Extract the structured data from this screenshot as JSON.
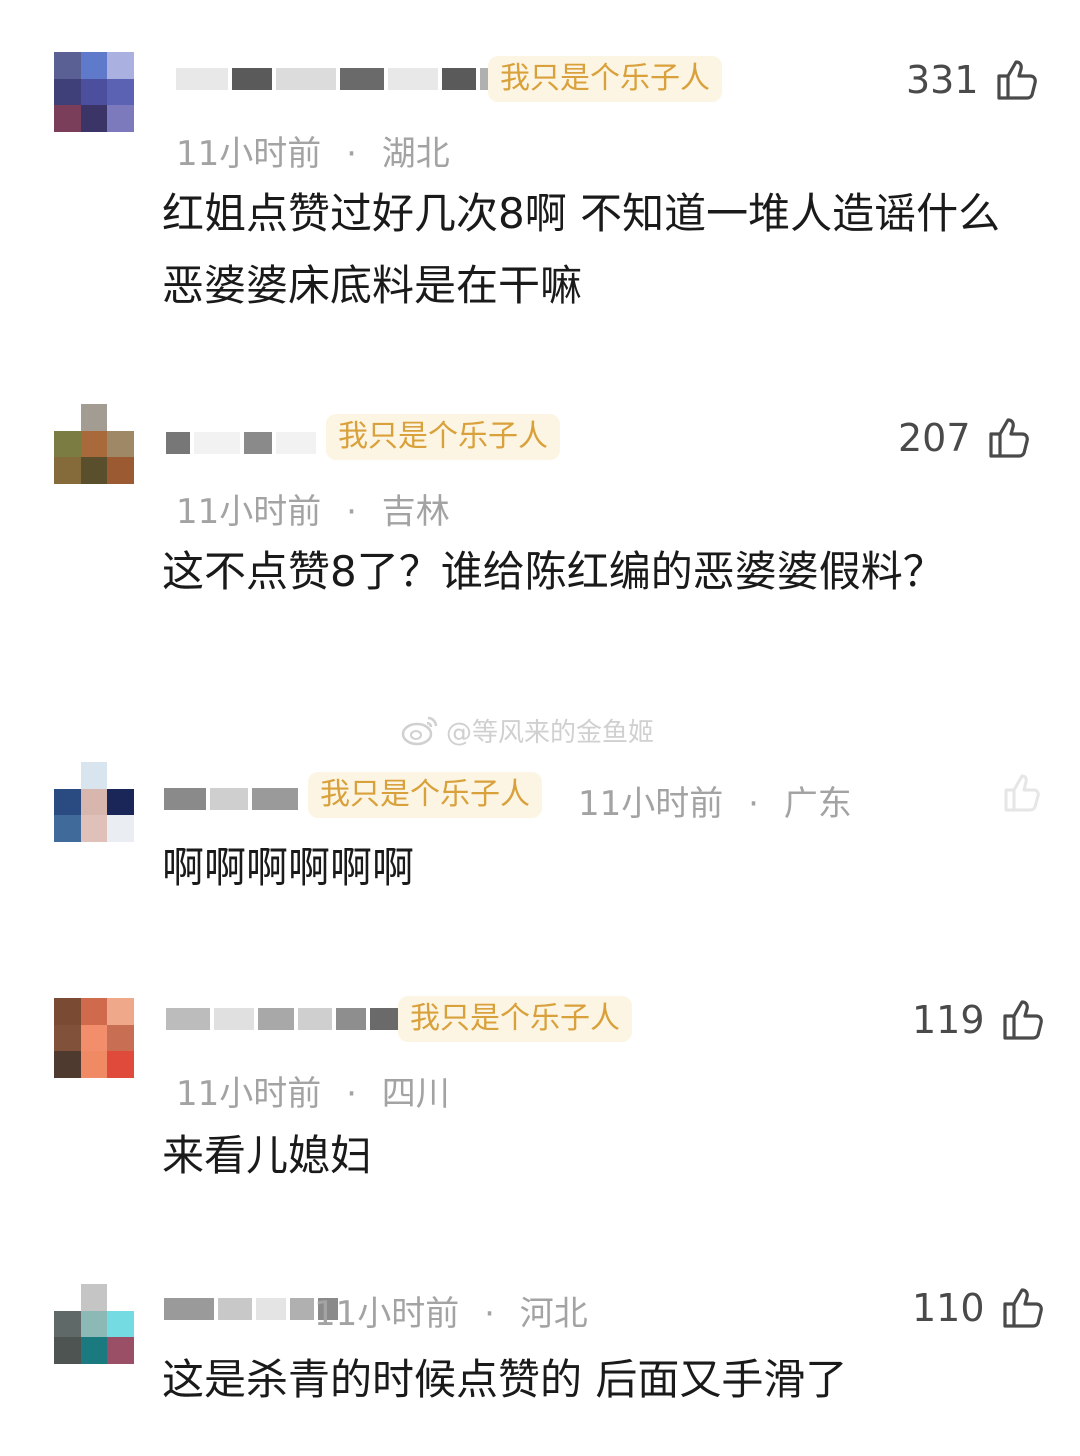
{
  "comments": [
    {
      "badge": "我只是个乐子人",
      "time": "11小时前",
      "location": "湖北",
      "text": "红姐点赞过好几次8啊 不知道一堆人造谣什么恶婆婆床底料是在干嘛",
      "likes": "331",
      "avatar_colors": [
        "#5a5f94",
        "#5f79cb",
        "#aab0e0",
        "#3f3f7a",
        "#4b4f9e",
        "#5b61b3",
        "#7a3d5a",
        "#3a3566",
        "#7c79bd"
      ]
    },
    {
      "badge": "我只是个乐子人",
      "time": "11小时前",
      "location": "吉林",
      "text": "这不点赞8了？谁给陈红编的恶婆婆假料？",
      "likes": "207",
      "avatar_colors": [
        "#ffffff",
        "#a39c93",
        "#ffffff",
        "#7a7c41",
        "#a86a3b",
        "#9e8866",
        "#856a3a",
        "#5a4f2d",
        "#9c5a32"
      ]
    },
    {
      "badge": "我只是个乐子人",
      "time": "11小时前",
      "location": "广东",
      "text": "啊啊啊啊啊啊",
      "likes": "",
      "avatar_colors": [
        "#ffffff",
        "#d8e5ef",
        "#ffffff",
        "#2a4a82",
        "#d6b6ad",
        "#1a2658",
        "#3f6a9a",
        "#e0c1ba",
        "#eaeef3"
      ]
    },
    {
      "badge": "我只是个乐子人",
      "time": "11小时前",
      "location": "四川",
      "text": "来看儿媳妇",
      "likes": "119",
      "avatar_colors": [
        "#7a4a33",
        "#d06a4d",
        "#f0a88a",
        "#82513a",
        "#f28e6c",
        "#c86e53",
        "#4e3a2e",
        "#f08a65",
        "#e04a3a"
      ]
    },
    {
      "badge": "",
      "time": "11小时前",
      "location": "河北",
      "text": "这是杀青的时候点赞的 后面又手滑了",
      "likes": "110",
      "avatar_colors": [
        "#ffffff",
        "#c5c5c5",
        "#ffffff",
        "#5f6a68",
        "#8cb8b6",
        "#74dbe2",
        "#4e5452",
        "#1a7a80",
        "#9a4f66"
      ]
    }
  ],
  "watermark": "@等风来的金鱼姬",
  "sep": "·"
}
